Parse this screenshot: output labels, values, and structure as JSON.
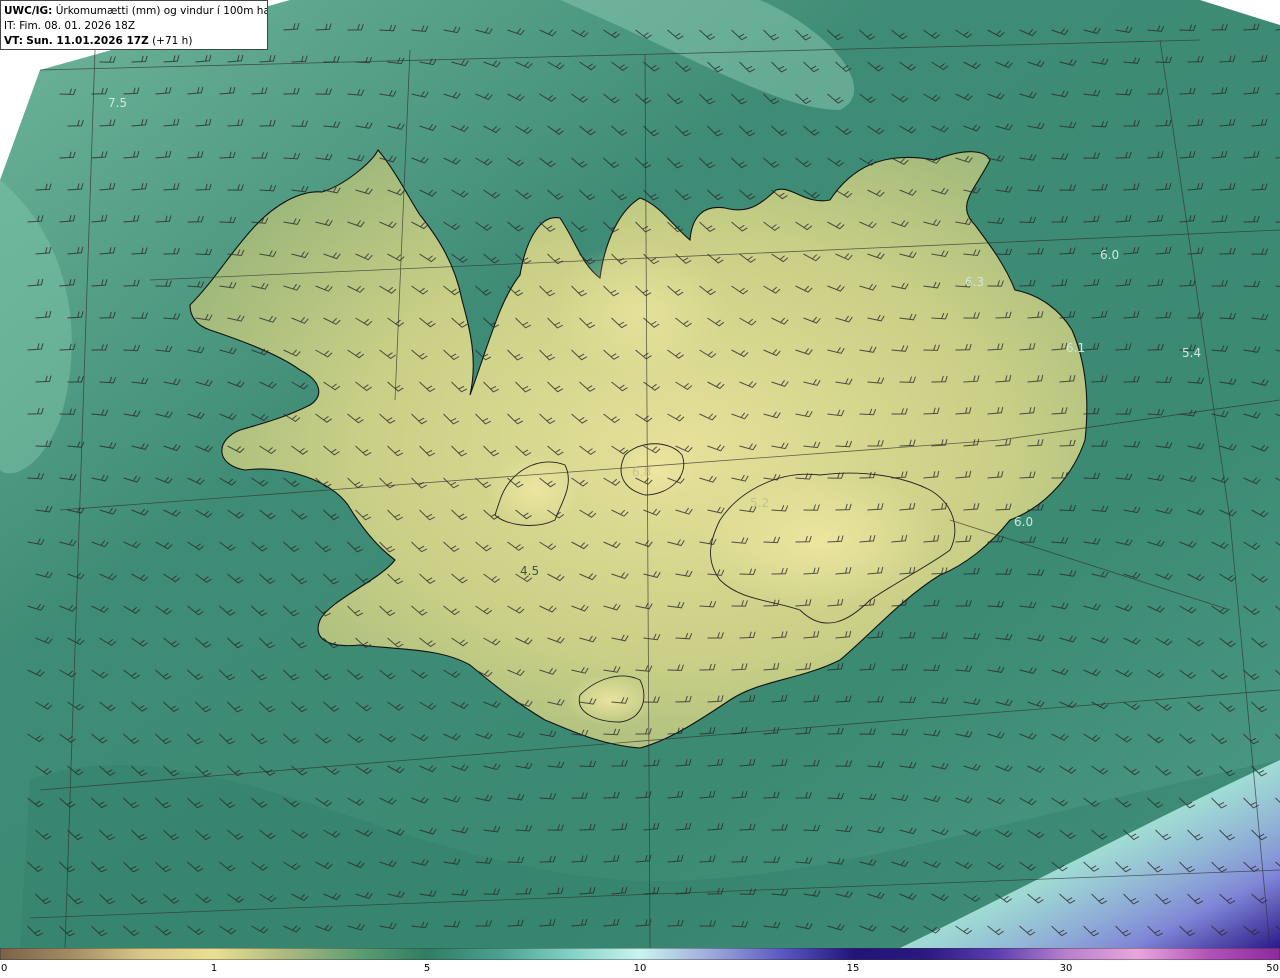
{
  "header": {
    "model": "UWC/IG:",
    "title": "Úrkomumætti (mm) og vindur í 100m hæð",
    "it_prefix": "IT:",
    "it_value": "Fim. 08. 01. 2026 18Z",
    "vt_prefix": "VT:",
    "vt_value": "Sun. 11.01.2026 17Z",
    "lead": "(+71 h)"
  },
  "map_labels": [
    "7.5",
    "6.0",
    "6.3",
    "6.1",
    "5.4",
    "6.0",
    "4.5",
    "6.8",
    "5.2"
  ],
  "colorbar": {
    "ticks": [
      "0",
      "1",
      "5",
      "10",
      "15",
      "30",
      "50"
    ],
    "stops": [
      "#7a6248",
      "#a38d62",
      "#d7c788",
      "#e9df92",
      "#aeb97f",
      "#5f9f73",
      "#2f7d62",
      "#4aa090",
      "#7fd0c4",
      "#c9f4ef",
      "#9da8dc",
      "#5a58c2",
      "#22147a",
      "#2b1880",
      "#5a3db0",
      "#b880cc",
      "#e8a6dc",
      "#b252b8",
      "#8a2a9e"
    ]
  },
  "colors": {
    "ocean": "#3f8c76",
    "land": "#d7d98c",
    "coast": "#111111",
    "barb": "#2a2a2a"
  },
  "icons": [
    "wind-barb-icon"
  ]
}
